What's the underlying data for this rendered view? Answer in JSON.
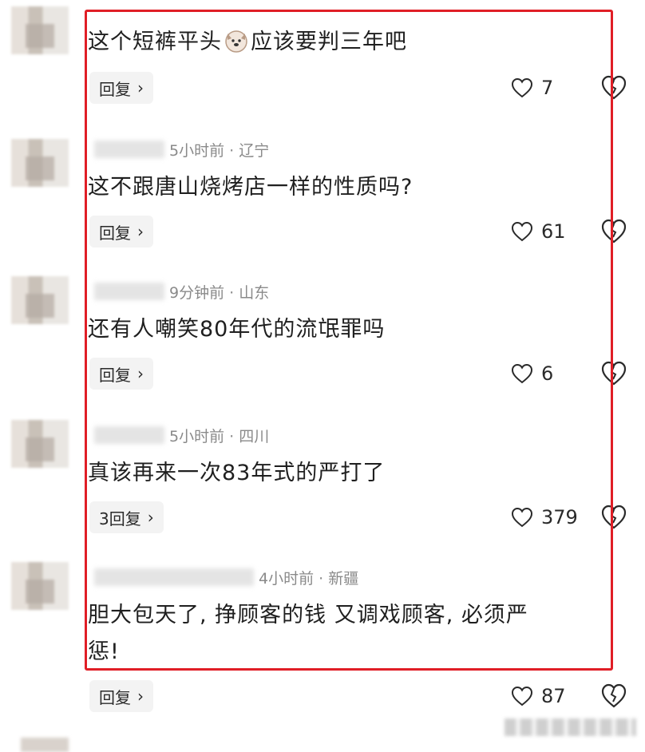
{
  "comments": [
    {
      "meta_time": "",
      "meta_location": "",
      "text_before": "这个短裤平头",
      "text_after": "应该要判三年吧",
      "reply_label": "回复",
      "likes": "7"
    },
    {
      "meta_time": "5小时前",
      "meta_location": "· 辽宁",
      "text": "这不跟唐山烧烤店一样的性质吗?",
      "reply_label": "回复",
      "likes": "61"
    },
    {
      "meta_time": "9分钟前",
      "meta_location": "· 山东",
      "text": "还有人嘲笑80年代的流氓罪吗",
      "reply_label": "回复",
      "likes": "6"
    },
    {
      "meta_time": "5小时前",
      "meta_location": "· 四川",
      "text": "真该再来一次83年式的严打了",
      "reply_label": "3回复",
      "likes": "379"
    },
    {
      "meta_time": "4小时前",
      "meta_location": "· 新疆",
      "text_line1": "胆大包天了, 挣顾客的钱 又调戏顾客, 必须严",
      "text_line2": "惩!",
      "reply_label": "回复",
      "likes": "87"
    }
  ],
  "icons": {
    "like": "heart-icon",
    "dislike": "broken-heart-icon",
    "reply_arrow": "chevron-right-icon",
    "emoji": "dog-emoji-icon"
  },
  "colors": {
    "highlight": "#e01e26",
    "reply_bg": "#f3f3f3"
  }
}
